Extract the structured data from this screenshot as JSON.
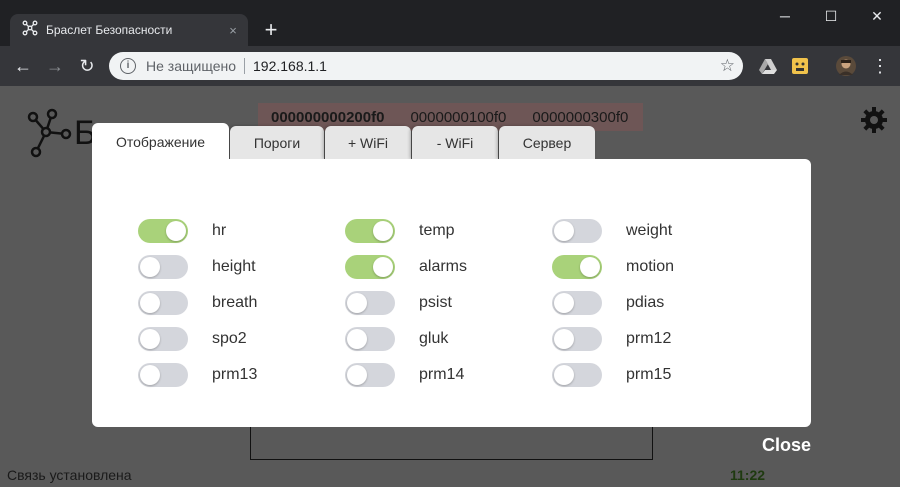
{
  "browser": {
    "tab_title": "Браслет Безопасности",
    "tab_close": "×",
    "new_tab": "+",
    "window_controls": {
      "minimize": "─",
      "maximize": "☐",
      "close": "✕"
    },
    "nav": {
      "back": "←",
      "forward": "→",
      "reload": "↻"
    },
    "address": {
      "info": "i",
      "security_text": "Не защищено",
      "url": "192.168.1.1",
      "bookmark": "☆"
    },
    "menu": "⋮"
  },
  "page": {
    "title_partial": "Б",
    "device_tabs": [
      {
        "label": "000000000200f0",
        "active": true
      },
      {
        "label": "0000000100f0",
        "active": false
      },
      {
        "label": "0000000300f0",
        "active": false
      }
    ],
    "status_text": "Связь установлена",
    "status_time": "11:22",
    "close_label": "Close"
  },
  "modal": {
    "tabs": [
      "Отображение",
      "Пороги",
      "+ WiFi",
      "- WiFi",
      "Сервер"
    ],
    "active_tab": 0,
    "toggles": [
      {
        "label": "hr",
        "on": true
      },
      {
        "label": "height",
        "on": false
      },
      {
        "label": "breath",
        "on": false
      },
      {
        "label": "spo2",
        "on": false
      },
      {
        "label": "prm13",
        "on": false
      },
      {
        "label": "temp",
        "on": true
      },
      {
        "label": "alarms",
        "on": true
      },
      {
        "label": "psist",
        "on": false
      },
      {
        "label": "gluk",
        "on": false
      },
      {
        "label": "prm14",
        "on": false
      },
      {
        "label": "weight",
        "on": false
      },
      {
        "label": "motion",
        "on": true
      },
      {
        "label": "pdias",
        "on": false
      },
      {
        "label": "prm12",
        "on": false
      },
      {
        "label": "prm15",
        "on": false
      }
    ]
  },
  "colors": {
    "toggle_on": "#a9d27a",
    "toggle_off": "#d4d6dc",
    "overlay": "#595959"
  }
}
